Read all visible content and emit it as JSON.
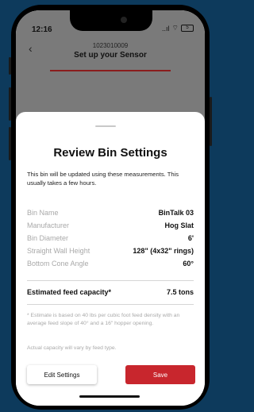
{
  "status": {
    "time": "12:16",
    "signal": "..ıl",
    "wifi": "⌔",
    "battery": "5"
  },
  "header": {
    "id": "1023010009",
    "title": "Set up your Sensor",
    "back_glyph": "‹"
  },
  "sheet": {
    "title": "Review Bin Settings",
    "intro": "This bin will be updated using these measurements. This usually takes a few hours.",
    "rows": [
      {
        "label": "Bin Name",
        "value": "BinTalk 03"
      },
      {
        "label": "Manufacturer",
        "value": "Hog Slat"
      },
      {
        "label": "Bin Diameter",
        "value": "6'"
      },
      {
        "label": "Straight Wall Height",
        "value": "128\" (4x32\" rings)"
      },
      {
        "label": "Bottom Cone Angle",
        "value": "60°"
      }
    ],
    "estimate": {
      "label": "Estimated feed capacity*",
      "value": "7.5 tons"
    },
    "note": "* Estimate is based on 40 lbs per cubic foot feed density with an average feed slope of 40° and a 16\" hopper opening.",
    "note2": "Actual capacity will vary by feed type.",
    "edit_label": "Edit Settings",
    "save_label": "Save"
  },
  "colors": {
    "accent": "#c8262d",
    "background": "#0d3a5c"
  }
}
